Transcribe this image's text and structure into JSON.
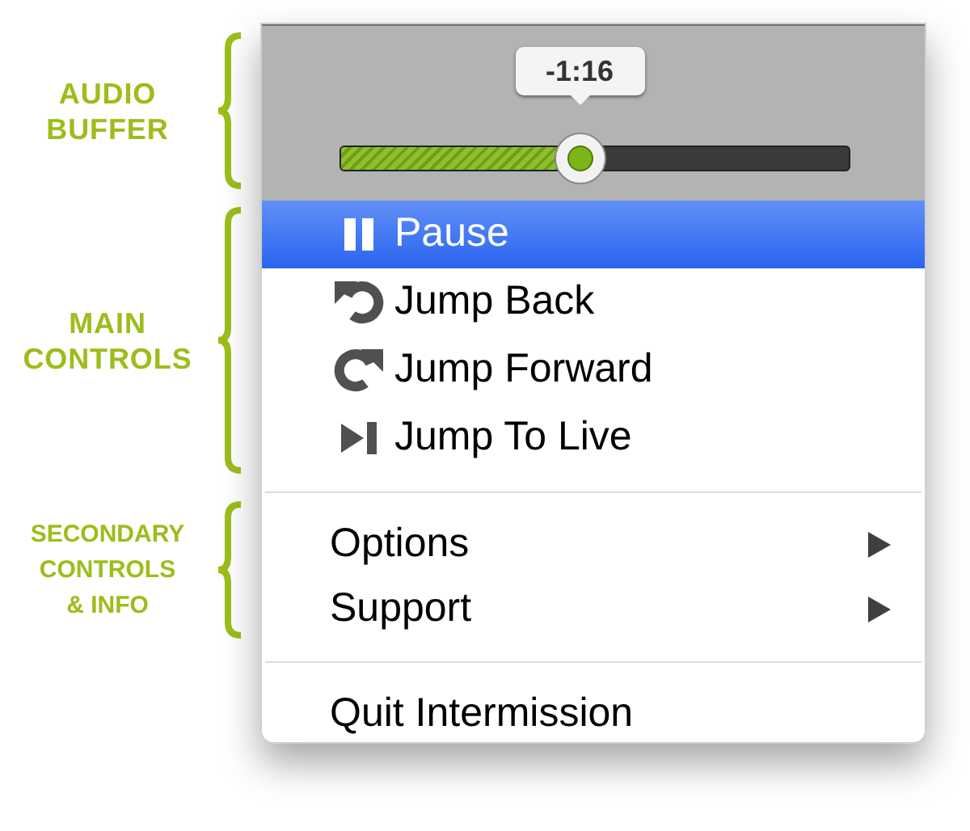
{
  "annotations": [
    {
      "lines": [
        "AUDIO",
        "BUFFER"
      ]
    },
    {
      "lines": [
        "MAIN",
        "CONTROLS"
      ]
    },
    {
      "lines": [
        "SECONDARY",
        "CONTROLS",
        "& INFO"
      ]
    }
  ],
  "buffer": {
    "tooltip": "-1:16",
    "level": 0.47
  },
  "menu": [
    {
      "kind": "action",
      "label": "Pause",
      "selected": true
    },
    {
      "kind": "action",
      "label": "Jump Back",
      "selected": false
    },
    {
      "kind": "action",
      "label": "Jump Forward",
      "selected": false
    },
    {
      "kind": "action",
      "label": "Jump To Live",
      "selected": false
    },
    {
      "kind": "separator"
    },
    {
      "kind": "submenu",
      "label": "Options",
      "selected": false
    },
    {
      "kind": "submenu",
      "label": "Support",
      "selected": false
    },
    {
      "kind": "separator"
    },
    {
      "kind": "plain",
      "label": "Quit Intermission",
      "selected": false
    }
  ]
}
